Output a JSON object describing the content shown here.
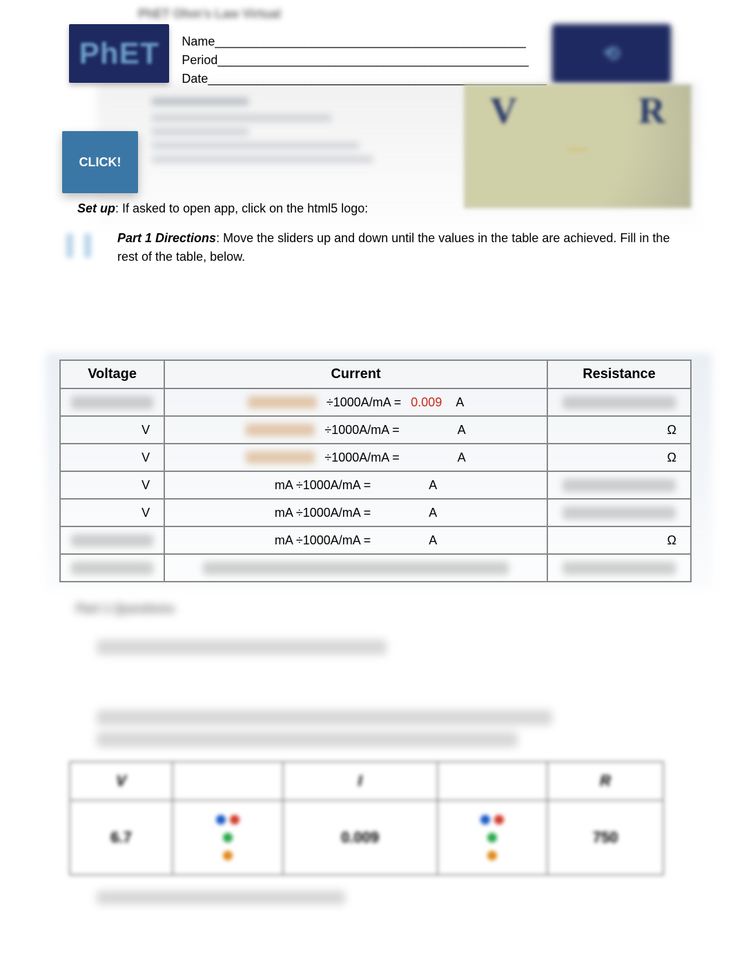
{
  "header": {
    "blur_title": "PhET Ohm's Law Virtual",
    "logo_text": "PhET",
    "name_label": "Name",
    "period_label": "Period",
    "date_label": "Date",
    "name_line": "_____________________________________________",
    "period_line": "_____________________________________________",
    "date_line": "_________________________________________________"
  },
  "click_label": "CLICK!",
  "sim_letters": {
    "v": "V",
    "dash": "—",
    "r": "R"
  },
  "setup": {
    "label": "Set up",
    "text": ": If asked to open app, click on the html5 logo:"
  },
  "part1": {
    "label": "Part 1 Directions",
    "text": ": Move the sliders up and down until the values in the table are achieved.  Fill in the rest of the table, below."
  },
  "table1": {
    "headers": {
      "voltage": "Voltage",
      "current": "Current",
      "resistance": "Resistance"
    },
    "unit_v": "V",
    "unit_a": "A",
    "unit_o": "Ω",
    "conv_a": "÷1000A/mA =",
    "conv_b": "mA ÷1000A/mA =",
    "rows": [
      {
        "v_blur": true,
        "c_prefix_blur": true,
        "conv": "conv_a",
        "c_val": "0.009",
        "a": "A",
        "r_blur": true,
        "r_unit": ""
      },
      {
        "v_unit": true,
        "c_prefix_blur": true,
        "conv": "conv_a",
        "c_val": "",
        "a": "A",
        "r_unit": "Ω"
      },
      {
        "v_unit": true,
        "c_prefix_blur": true,
        "conv": "conv_a",
        "c_val": "",
        "a": "A",
        "r_unit": "Ω"
      },
      {
        "v_unit": true,
        "c_prefix_blur": false,
        "conv": "conv_b",
        "c_val": "",
        "a": "A",
        "r_blur": true,
        "r_unit": ""
      },
      {
        "v_unit": true,
        "c_prefix_blur": false,
        "conv": "conv_b",
        "c_val": "",
        "a": "A",
        "r_blur": true,
        "r_unit": ""
      },
      {
        "v_blur": true,
        "c_prefix_blur": false,
        "conv": "conv_b",
        "c_val": "",
        "a": "A",
        "r_unit": "Ω"
      },
      {
        "v_blur": true,
        "row_blur": true
      }
    ]
  },
  "questions_header": "Part 1 Questions",
  "table2": {
    "headers": {
      "v": "V",
      "i": "I",
      "r": "R"
    },
    "values": {
      "v": "6.7",
      "i": "0.009",
      "r": "750"
    }
  }
}
